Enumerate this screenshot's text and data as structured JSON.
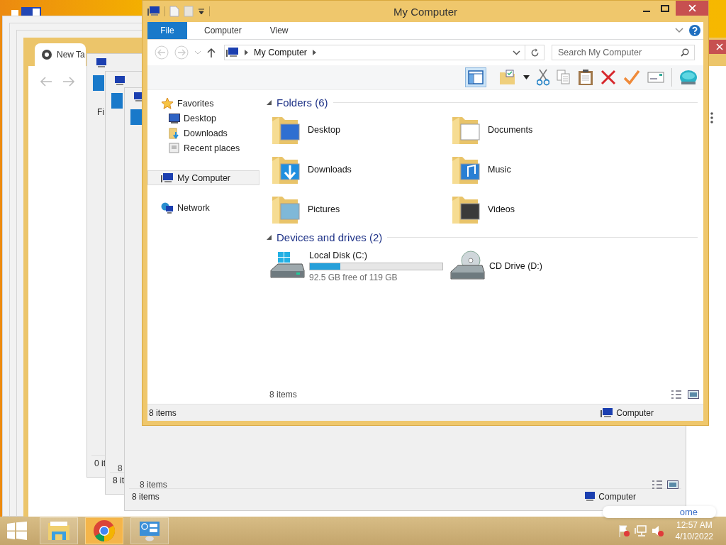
{
  "background_windows": {
    "browser": {
      "tab": "New Ta",
      "bubble": "ome"
    },
    "explorers": [
      {
        "ribbon_fragment": "Fi",
        "status": "0 it"
      },
      {
        "item_count": "8",
        "status": "8 it"
      },
      {
        "item_count": "8 items",
        "status": "8 items",
        "location": "Computer"
      }
    ]
  },
  "window": {
    "title": "My Computer",
    "ribbon_tabs": [
      {
        "label": "File",
        "kind": "file",
        "selected": false
      },
      {
        "label": "Computer",
        "kind": "tab",
        "selected": false
      },
      {
        "label": "View",
        "kind": "tab",
        "selected": false
      }
    ],
    "address": {
      "path": "My Computer"
    },
    "search": {
      "placeholder": "Search My Computer"
    },
    "navigation": [
      {
        "label": "Favorites",
        "kind": "favorites",
        "selected": false,
        "children": [
          {
            "label": "Desktop",
            "kind": "desktop",
            "selected": false
          },
          {
            "label": "Downloads",
            "kind": "downloads",
            "selected": false
          },
          {
            "label": "Recent places",
            "kind": "recent",
            "selected": false
          }
        ]
      },
      {
        "label": "My Computer",
        "kind": "computer",
        "selected": true
      },
      {
        "label": "Network",
        "kind": "network",
        "selected": false
      }
    ],
    "groups": [
      {
        "title": "Folders (6)",
        "items": [
          {
            "name": "Desktop",
            "kind": "desktop"
          },
          {
            "name": "Documents",
            "kind": "documents"
          },
          {
            "name": "Downloads",
            "kind": "downloads"
          },
          {
            "name": "Music",
            "kind": "music"
          },
          {
            "name": "Pictures",
            "kind": "pictures"
          },
          {
            "name": "Videos",
            "kind": "videos"
          }
        ]
      },
      {
        "title": "Devices and drives (2)",
        "items": [
          {
            "name": "Local Disk (C:)",
            "kind": "disk",
            "level": 0.23,
            "detail": "92.5 GB free of 119 GB"
          },
          {
            "name": "CD Drive (D:)",
            "kind": "cd"
          }
        ]
      }
    ],
    "item_count": "8 items",
    "status_bar": {
      "items": "8 items",
      "location": "Computer"
    }
  },
  "taskbar": {
    "apps": [
      {
        "kind": "explorer",
        "selected": false
      },
      {
        "kind": "chrome",
        "selected": true
      },
      {
        "kind": "control-panel",
        "selected": false
      }
    ],
    "clock": {
      "time": "12:57 AM",
      "date": "4/10/2022"
    }
  }
}
